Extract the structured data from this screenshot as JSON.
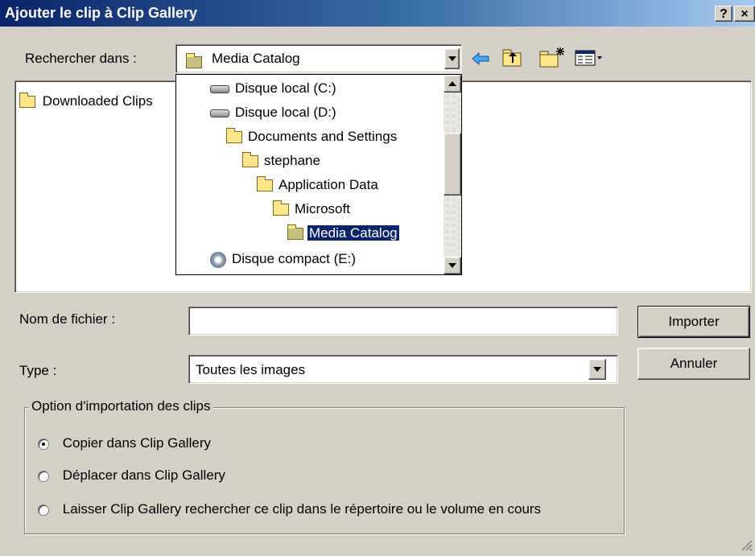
{
  "window": {
    "title": "Ajouter le clip à Clip Gallery",
    "help_label": "?",
    "close_label": "×"
  },
  "lookin": {
    "label": "Rechercher dans :",
    "value": "Media Catalog"
  },
  "toolbar": {
    "back_icon": "arrow-left-icon",
    "up_icon": "folder-up-icon",
    "new_folder_icon": "new-folder-icon",
    "view_icon": "view-menu-icon"
  },
  "file_list": {
    "items": [
      {
        "label": "Downloaded Clips",
        "icon": "folder-icon"
      }
    ]
  },
  "dropdown": {
    "items": [
      {
        "label": "Disque local (C:)",
        "icon": "hard-drive-icon"
      },
      {
        "label": "Disque local (D:)",
        "icon": "hard-drive-icon"
      },
      {
        "label": "Documents and Settings",
        "icon": "folder-icon"
      },
      {
        "label": "stephane",
        "icon": "folder-icon"
      },
      {
        "label": "Application Data",
        "icon": "folder-icon"
      },
      {
        "label": "Microsoft",
        "icon": "folder-icon"
      },
      {
        "label": "Media Catalog",
        "icon": "open-folder-icon",
        "selected": true
      },
      {
        "label": "Disque compact (E:)",
        "icon": "cd-drive-icon"
      }
    ]
  },
  "filename": {
    "label": "Nom de fichier :",
    "value": ""
  },
  "type": {
    "label": "Type :",
    "value": "Toutes les images"
  },
  "buttons": {
    "import": "Importer",
    "cancel": "Annuler"
  },
  "import_options": {
    "legend": "Option d'importation des clips",
    "options": [
      {
        "label": "Copier dans Clip Gallery",
        "checked": true
      },
      {
        "label": "Déplacer dans Clip Gallery",
        "checked": false
      },
      {
        "label": "Laisser Clip Gallery rechercher ce clip dans le répertoire ou le volume en cours",
        "checked": false
      }
    ]
  }
}
